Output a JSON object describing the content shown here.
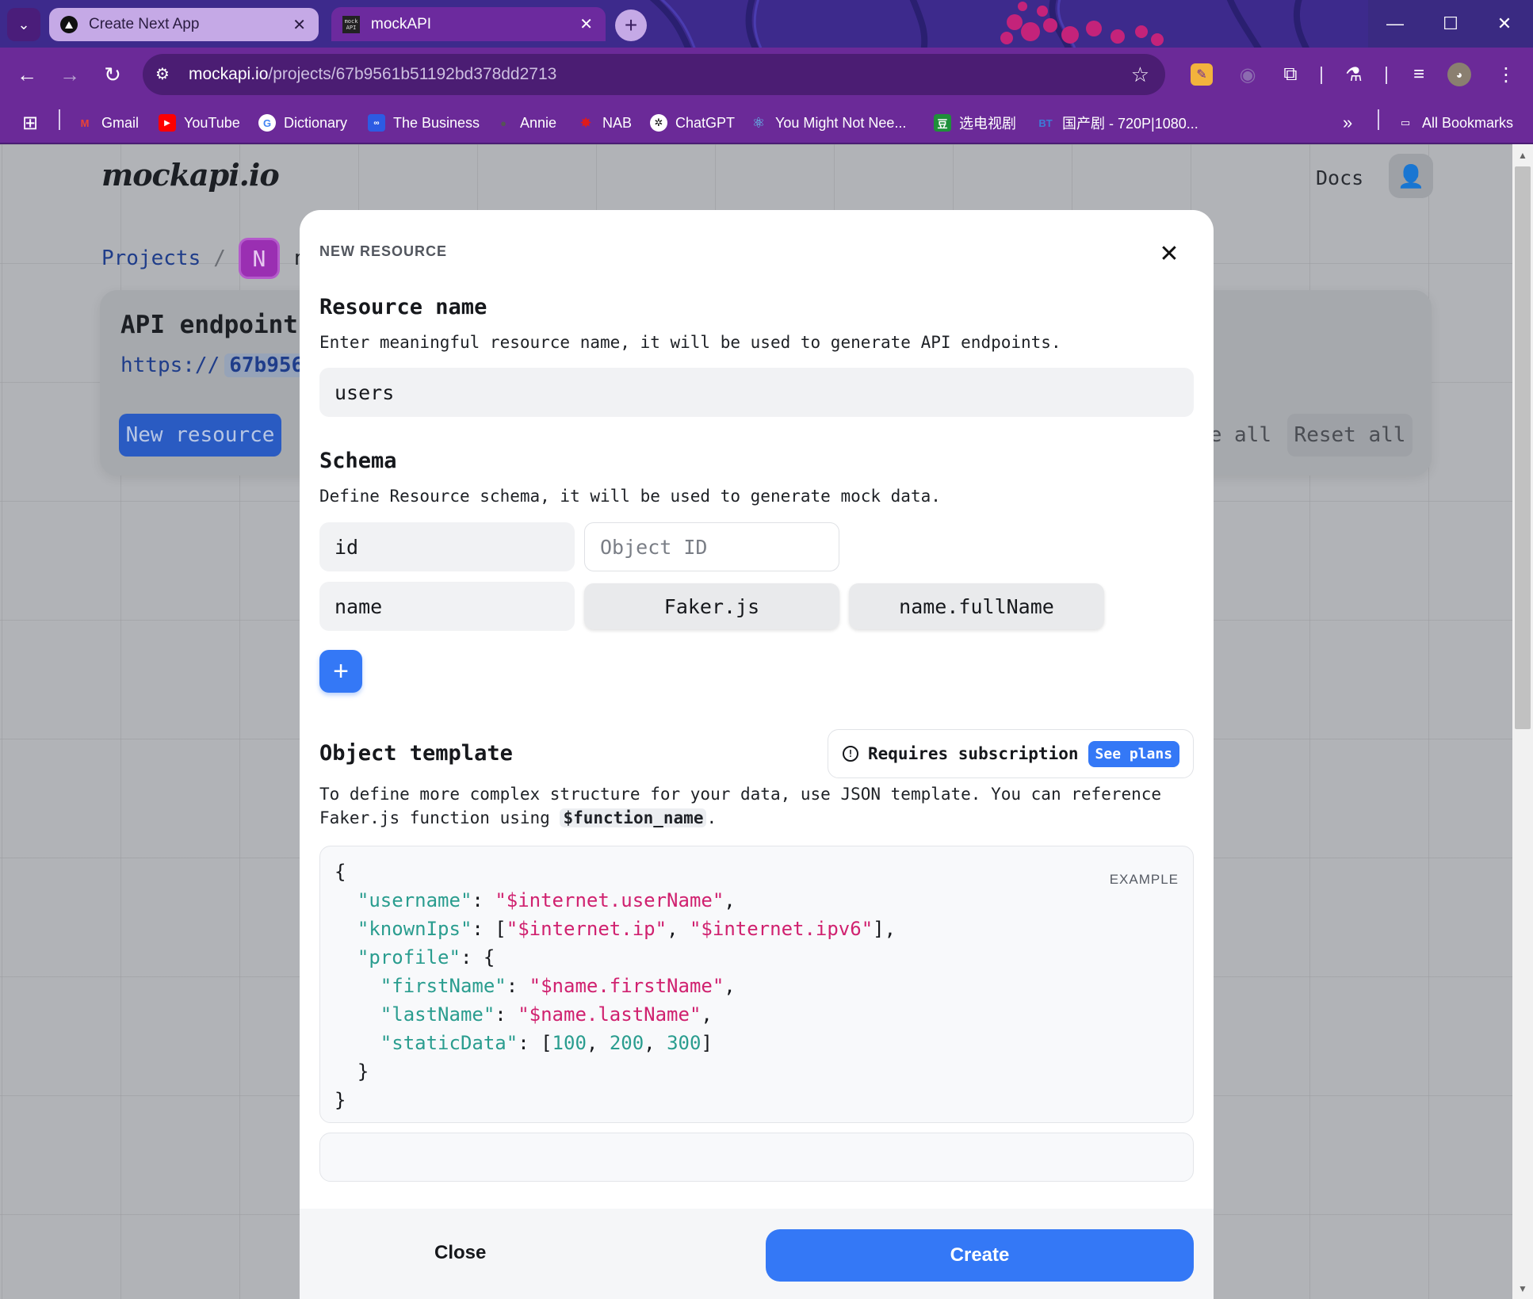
{
  "browser": {
    "tabs": [
      {
        "title": "Create Next App",
        "active": false
      },
      {
        "title": "mockAPI",
        "active": true
      }
    ],
    "address": {
      "host": "mockapi.io",
      "path": "/projects/67b9561b51192bd378dd2713"
    },
    "bookmarks": [
      {
        "label": "Gmail"
      },
      {
        "label": "YouTube"
      },
      {
        "label": "Dictionary"
      },
      {
        "label": "The Business"
      },
      {
        "label": "Annie"
      },
      {
        "label": "NAB"
      },
      {
        "label": "ChatGPT"
      },
      {
        "label": "You Might Not Nee..."
      },
      {
        "label": "选电视剧"
      },
      {
        "label": "国产剧 - 720P|1080..."
      }
    ],
    "all_bookmarks": "All Bookmarks",
    "colors": {
      "accent": "#6b2a98",
      "tabstrip": "#3d2a8c"
    }
  },
  "site": {
    "logo": "mockapi.io",
    "docs": "Docs",
    "breadcrumb": {
      "projects": "Projects",
      "separator": "/",
      "project_initial": "N",
      "project_name_partial": "n"
    },
    "card": {
      "title": "API endpoint",
      "endpoint_prefix": "https://",
      "endpoint_id_partial": "67b9561b",
      "new_resource": "New resource",
      "delete_all_partial": "e all",
      "reset_all": "Reset all"
    }
  },
  "modal": {
    "eyebrow": "NEW RESOURCE",
    "resource_name": {
      "heading": "Resource name",
      "description": "Enter meaningful resource name, it will be used to generate API endpoints.",
      "value": "users"
    },
    "schema": {
      "heading": "Schema",
      "description": "Define Resource schema, it will be used to generate mock data.",
      "rows": [
        {
          "field": "id",
          "type": "Object ID"
        },
        {
          "field": "name",
          "type": "Faker.js",
          "method": "name.fullName"
        }
      ]
    },
    "object_template": {
      "heading": "Object template",
      "subscription_note": "Requires subscription",
      "see_plans": "See plans",
      "description_1": "To define more complex structure for your data, use JSON template. You can reference",
      "description_2a": "Faker.js function using",
      "description_code": "$function_name",
      "description_2b": ".",
      "example_label": "EXAMPLE"
    },
    "footer": {
      "close": "Close",
      "create": "Create"
    }
  }
}
